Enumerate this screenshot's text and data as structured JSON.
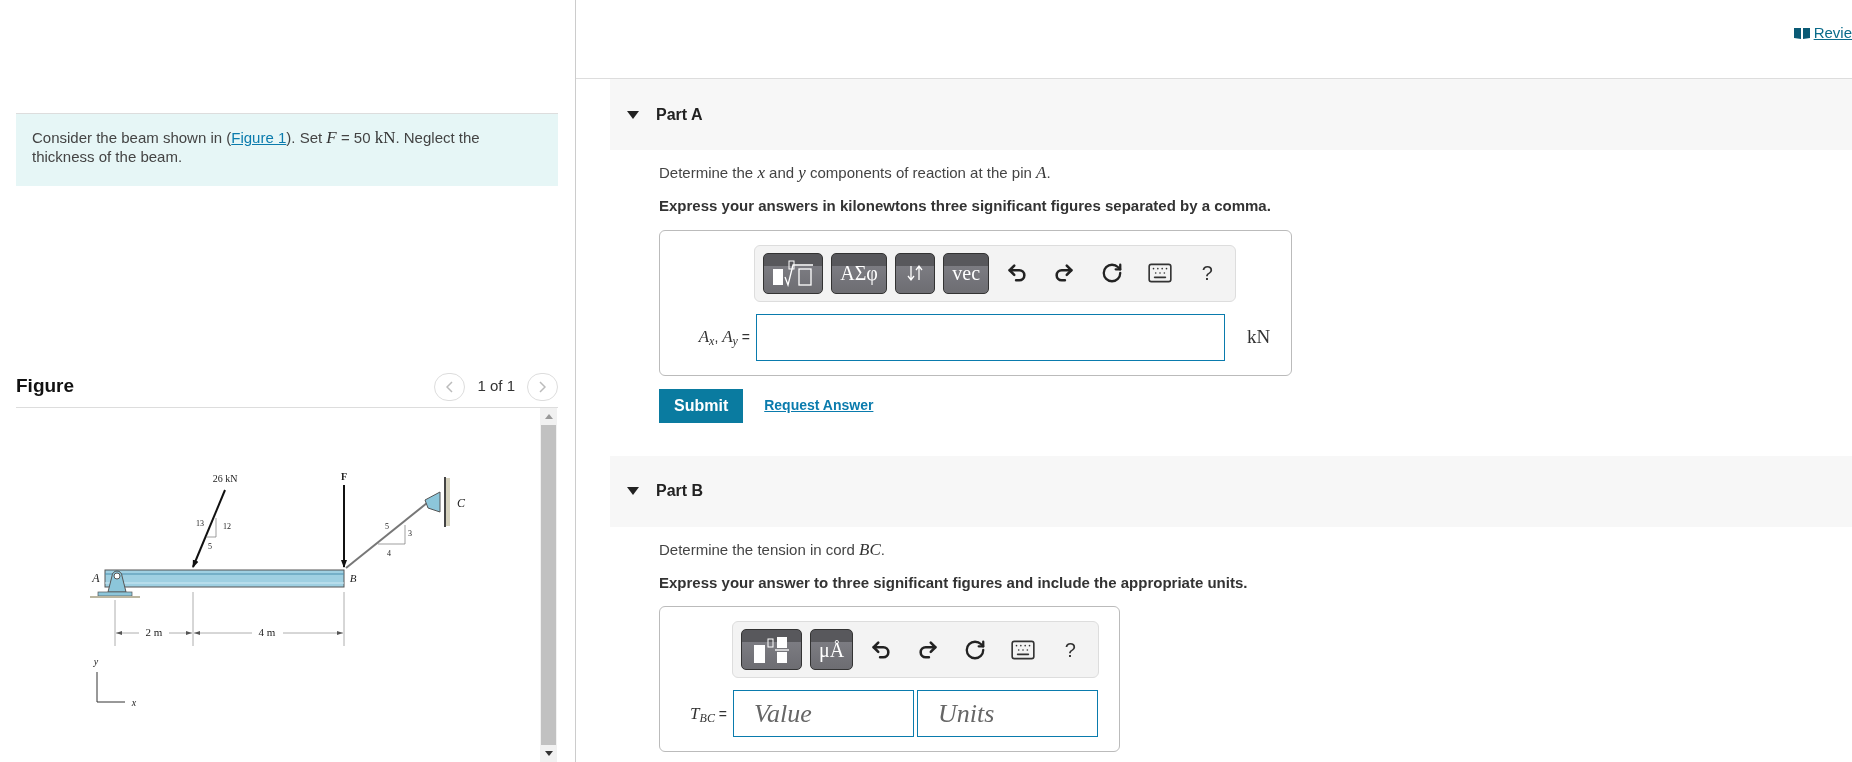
{
  "review_link": "Revie",
  "problem": {
    "segments": [
      {
        "kind": "text",
        "text": "Consider the beam shown in ("
      },
      {
        "kind": "link",
        "text": "Figure 1"
      },
      {
        "kind": "text",
        "text": "). Set "
      },
      {
        "kind": "math",
        "text": "F"
      },
      {
        "kind": "text",
        "text": " = 50 "
      },
      {
        "kind": "unit",
        "text": "kN"
      },
      {
        "kind": "text",
        "text": ". Neglect the thickness of the beam."
      }
    ]
  },
  "figure": {
    "title": "Figure",
    "pager": "1 of 1",
    "labels": [
      "26 kN",
      "F",
      "C",
      "13",
      "12",
      "5",
      "5",
      "3",
      "4",
      "A",
      "B",
      "2 m",
      "4 m",
      "y",
      "x"
    ]
  },
  "parts": [
    {
      "title": "Part A",
      "expanded": true,
      "prompt": [
        {
          "kind": "text",
          "text": "Determine the "
        },
        {
          "kind": "math",
          "text": "x"
        },
        {
          "kind": "text",
          "text": " and "
        },
        {
          "kind": "math",
          "text": "y"
        },
        {
          "kind": "text",
          "text": " components of reaction at the pin "
        },
        {
          "kind": "math",
          "text": "A"
        },
        {
          "kind": "text",
          "text": "."
        }
      ],
      "instruction": "Express your answers in kilonewtons three significant figures separated by a comma.",
      "toolbar": [
        {
          "kind": "templates"
        },
        {
          "kind": "label",
          "text": "ΑΣφ"
        },
        {
          "kind": "arrows"
        },
        {
          "kind": "label",
          "text": "vec"
        },
        {
          "kind": "undo"
        },
        {
          "kind": "redo"
        },
        {
          "kind": "reset"
        },
        {
          "kind": "keyboard"
        },
        {
          "kind": "help",
          "text": "?"
        }
      ],
      "answer_label": [
        {
          "kind": "math",
          "text": "A"
        },
        {
          "kind": "sub",
          "text": "x"
        },
        {
          "kind": "text",
          "text": ", "
        },
        {
          "kind": "math",
          "text": "A"
        },
        {
          "kind": "sub",
          "text": "y"
        },
        {
          "kind": "text",
          "text": " ="
        }
      ],
      "fields": [
        {
          "kind": "wide"
        }
      ],
      "unit": "kN",
      "buttons": [
        {
          "kind": "submit",
          "text": "Submit"
        },
        {
          "kind": "link",
          "text": "Request Answer"
        }
      ]
    },
    {
      "title": "Part B",
      "expanded": true,
      "prompt": [
        {
          "kind": "text",
          "text": "Determine the tension in cord "
        },
        {
          "kind": "math",
          "text": "BC"
        },
        {
          "kind": "text",
          "text": "."
        }
      ],
      "instruction": "Express your answer to three significant figures and include the appropriate units.",
      "toolbar": [
        {
          "kind": "unit-templates"
        },
        {
          "kind": "label",
          "text": "μÅ"
        },
        {
          "kind": "undo"
        },
        {
          "kind": "redo"
        },
        {
          "kind": "reset"
        },
        {
          "kind": "keyboard"
        },
        {
          "kind": "help",
          "text": "?"
        }
      ],
      "answer_label": [
        {
          "kind": "math",
          "text": "T"
        },
        {
          "kind": "sub",
          "text": "BC"
        },
        {
          "kind": "text",
          "text": " ="
        }
      ],
      "fields": [
        {
          "kind": "half",
          "placeholder": "Value"
        },
        {
          "kind": "half",
          "placeholder": "Units"
        }
      ]
    }
  ]
}
